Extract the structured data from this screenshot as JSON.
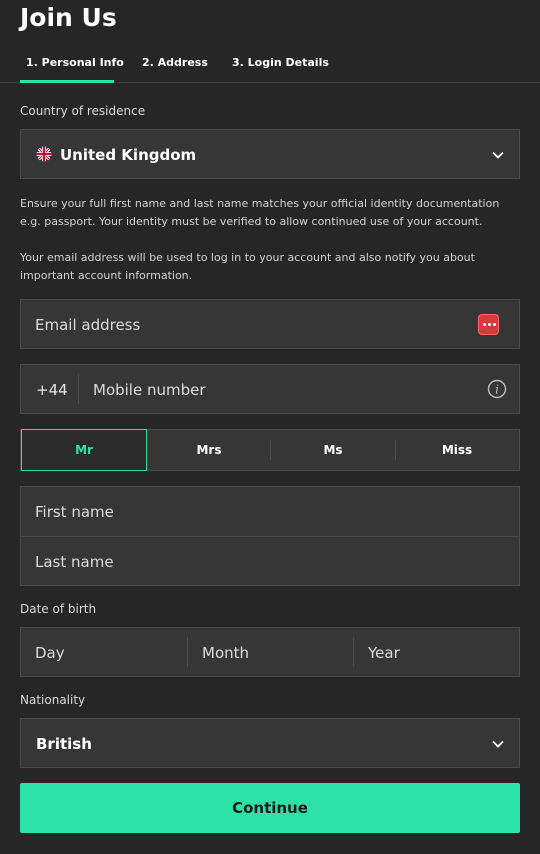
{
  "page": {
    "title": "Join Us"
  },
  "tabs": [
    {
      "label": "1. Personal Info"
    },
    {
      "label": "2. Address"
    },
    {
      "label": "3. Login Details"
    }
  ],
  "country": {
    "label": "Country of residence",
    "value": "United Kingdom",
    "icon": "uk-flag-icon"
  },
  "notices": {
    "identity": "Ensure your full first name and last name matches your official identity documentation e.g. passport. Your identity must be verified to allow continued use of your account.",
    "email": "Your email address will be used to log in to your account and also notify you about important account information."
  },
  "email": {
    "placeholder": "Email address",
    "value": ""
  },
  "mobile": {
    "prefix": "+44",
    "placeholder": "Mobile number",
    "value": ""
  },
  "salutation": {
    "options": [
      "Mr",
      "Mrs",
      "Ms",
      "Miss"
    ],
    "selected": "Mr"
  },
  "name": {
    "first": {
      "placeholder": "First name",
      "value": ""
    },
    "last": {
      "placeholder": "Last name",
      "value": ""
    }
  },
  "dob": {
    "label": "Date of birth",
    "day": {
      "placeholder": "Day"
    },
    "month": {
      "placeholder": "Month"
    },
    "year": {
      "placeholder": "Year"
    }
  },
  "nationality": {
    "label": "Nationality",
    "value": "British"
  },
  "actions": {
    "continue_label": "Continue"
  },
  "colors": {
    "accent": "#2de2a6",
    "background": "#262626",
    "field": "#363636",
    "password_icon": "#d63b3b"
  }
}
